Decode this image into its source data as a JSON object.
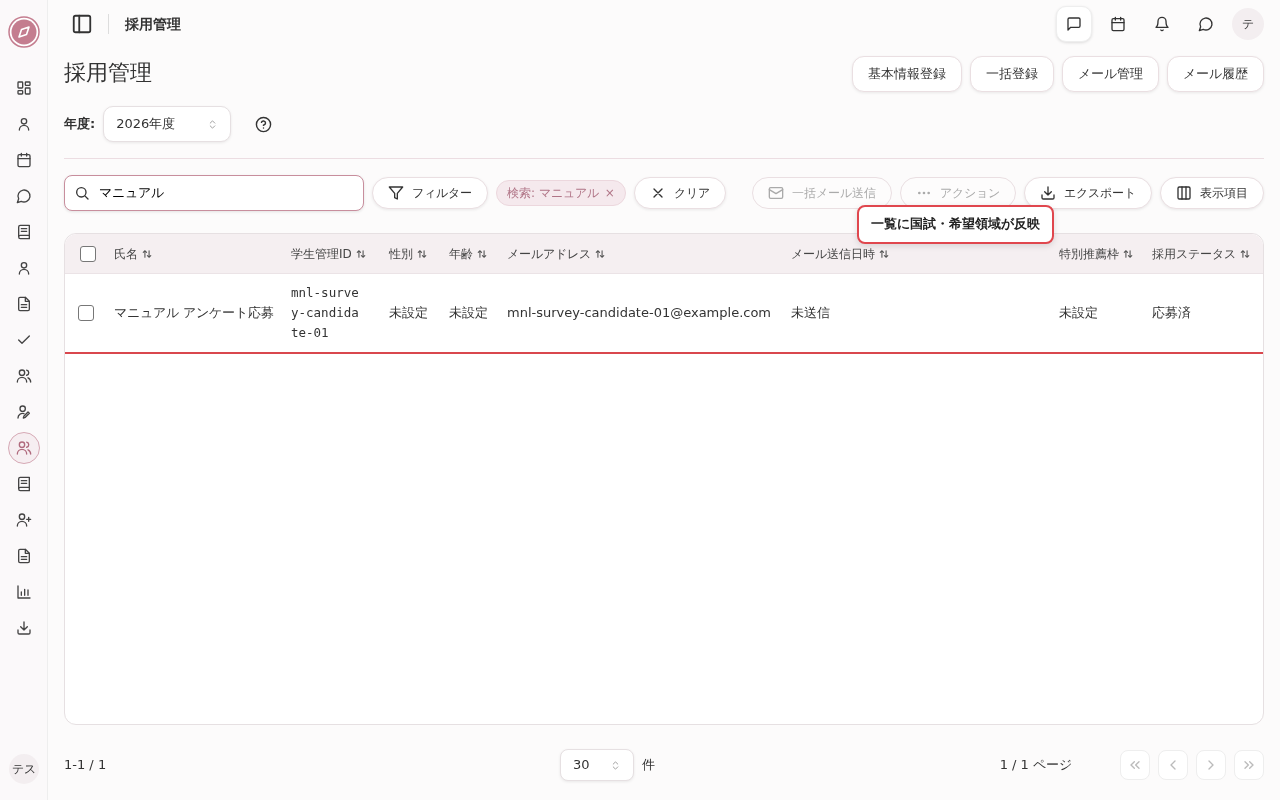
{
  "sidebar": {
    "items": [
      {
        "kind": "grid",
        "selected": false
      },
      {
        "kind": "user",
        "selected": false
      },
      {
        "kind": "calendar",
        "selected": false
      },
      {
        "kind": "chat",
        "selected": false
      },
      {
        "kind": "book",
        "selected": false
      },
      {
        "kind": "user",
        "selected": false
      },
      {
        "kind": "file",
        "selected": false
      },
      {
        "kind": "check",
        "selected": false
      },
      {
        "kind": "users",
        "selected": false
      },
      {
        "kind": "useredit",
        "selected": false
      },
      {
        "kind": "users",
        "selected": true
      },
      {
        "kind": "book",
        "selected": false
      },
      {
        "kind": "userplus",
        "selected": false
      },
      {
        "kind": "file",
        "selected": false
      },
      {
        "kind": "chart",
        "selected": false
      },
      {
        "kind": "download",
        "selected": false
      }
    ],
    "user_initials": "テス"
  },
  "topbar": {
    "title": "採用管理",
    "icons": [
      {
        "kind": "message",
        "selected": true
      },
      {
        "kind": "calendar",
        "selected": false
      },
      {
        "kind": "bell",
        "selected": false
      },
      {
        "kind": "chat",
        "selected": false
      }
    ],
    "avatar": "テ"
  },
  "page": {
    "title": "採用管理",
    "actions": [
      "基本情報登録",
      "一括登録",
      "メール管理",
      "メール履歴"
    ]
  },
  "year": {
    "label": "年度:",
    "value": "2026年度"
  },
  "search": {
    "value": "マニュアル"
  },
  "filter_button": "フィルター",
  "chips": [
    {
      "label": "検索: マニュアル",
      "remove": "×"
    }
  ],
  "clear_button": "クリア",
  "toolbar": [
    {
      "kind": "mail",
      "label": "一括メール送信",
      "disabled": true
    },
    {
      "kind": "dots",
      "label": "アクション",
      "disabled": true
    },
    {
      "kind": "download",
      "label": "エクスポート",
      "disabled": false
    },
    {
      "kind": "columns",
      "label": "表示項目",
      "disabled": false
    }
  ],
  "tooltip": "一覧に国試・希望領域が反映",
  "table": {
    "select_all": {
      "checked": false
    },
    "columns": [
      "氏名",
      "学生管理ID",
      "性別",
      "年齢",
      "メールアドレス",
      "メール送信日時",
      "特別推薦枠",
      "採用ステータス"
    ],
    "rows": [
      {
        "checked": false,
        "highlighted": true,
        "cells": [
          "マニュアル アンケート応募",
          "mnl-survey-candidate-01",
          "未設定",
          "未設定",
          "mnl-survey-candidate-01@example.com",
          "未送信",
          "未設定",
          "応募済"
        ]
      }
    ]
  },
  "footer": {
    "range": "1-1 / 1",
    "page_size": "30",
    "unit": "件",
    "pages": "1 / 1 ページ",
    "nav": [
      {
        "kind": "first",
        "disabled": true
      },
      {
        "kind": "prev",
        "disabled": true
      },
      {
        "kind": "next",
        "disabled": true
      },
      {
        "kind": "last",
        "disabled": true
      }
    ]
  }
}
